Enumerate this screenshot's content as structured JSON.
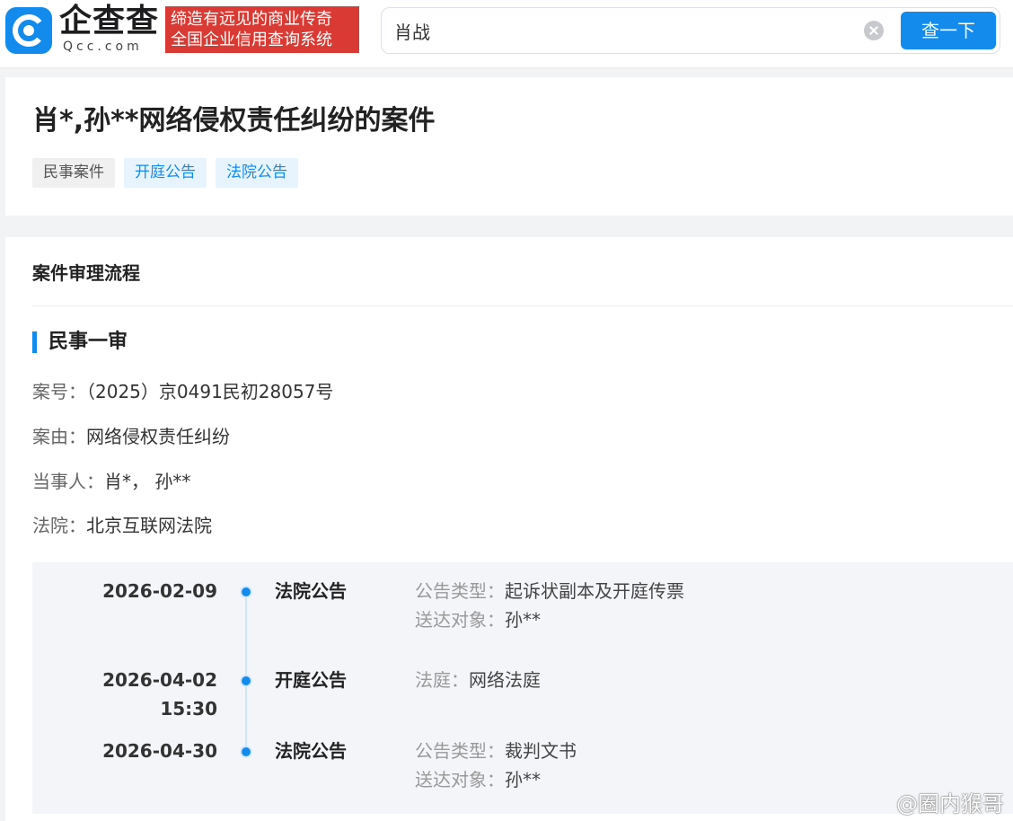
{
  "header": {
    "logo_cn": "企查查",
    "logo_en": "Qcc.com",
    "slogan_line1": "缔造有远见的商业传奇",
    "slogan_line2": "全国企业信用查询系统",
    "search_value": "肖战",
    "search_button": "查一下"
  },
  "case": {
    "title": "肖*,孙**网络侵权责任纠纷的案件",
    "tags": [
      "民事案件",
      "开庭公告",
      "法院公告"
    ]
  },
  "process": {
    "section_title": "案件审理流程",
    "stage_title": "民事一审",
    "fields": [
      {
        "label": "案号：",
        "value": "（2025）京0491民初28057号"
      },
      {
        "label": "案由：",
        "value": "网络侵权责任纠纷"
      },
      {
        "label": "当事人：",
        "value": "肖*， 孙**"
      },
      {
        "label": "法院：",
        "value": "北京互联网法院"
      }
    ],
    "timeline": [
      {
        "date": "2026-02-09",
        "time": "",
        "type": "法院公告",
        "details": [
          {
            "label": "公告类型：",
            "value": "起诉状副本及开庭传票"
          },
          {
            "label": "送达对象：",
            "value": "孙**"
          }
        ]
      },
      {
        "date": "2026-04-02",
        "time": "15:30",
        "type": "开庭公告",
        "details": [
          {
            "label": "法庭：",
            "value": "网络法庭"
          }
        ]
      },
      {
        "date": "2026-04-30",
        "time": "",
        "type": "法院公告",
        "details": [
          {
            "label": "公告类型：",
            "value": "裁判文书"
          },
          {
            "label": "送达对象：",
            "value": "孙**"
          }
        ]
      }
    ]
  },
  "watermark": "@圈内猴哥",
  "colors": {
    "brand_blue": "#128bed",
    "slogan_red": "#d93a33",
    "tag_blue_bg": "#e8f4fd"
  }
}
